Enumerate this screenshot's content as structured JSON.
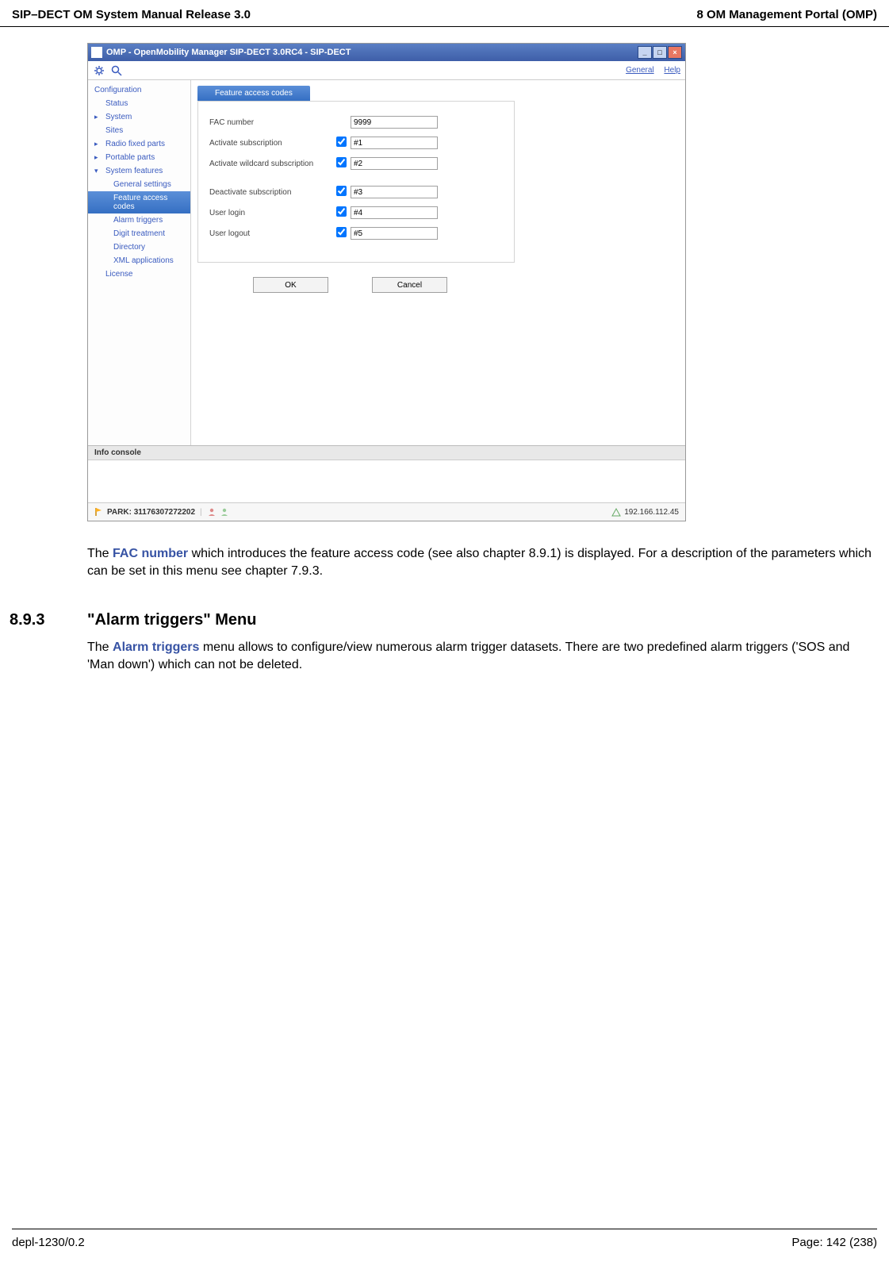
{
  "header": {
    "left": "SIP–DECT OM System Manual Release 3.0",
    "right": "8 OM Management Portal (OMP)"
  },
  "window": {
    "title": "OMP - OpenMobility Manager SIP-DECT 3.0RC4 - SIP-DECT",
    "links": {
      "general": "General",
      "help": "Help"
    }
  },
  "sidebar": {
    "root": "Configuration",
    "items": {
      "status": "Status",
      "system": "System",
      "sites": "Sites",
      "rfp": "Radio fixed parts",
      "pp": "Portable parts",
      "sysfeat": "System features",
      "license": "License"
    },
    "subs": {
      "general": "General settings",
      "fac": "Feature access codes",
      "alarm": "Alarm triggers",
      "digit": "Digit treatment",
      "directory": "Directory",
      "xml": "XML applications"
    }
  },
  "panel": {
    "tab": "Feature access codes",
    "rows": {
      "facnum": {
        "label": "FAC number",
        "value": "9999"
      },
      "actsub": {
        "label": "Activate subscription",
        "value": "#1"
      },
      "actwc": {
        "label": "Activate wildcard subscription",
        "value": "#2"
      },
      "deact": {
        "label": "Deactivate subscription",
        "value": "#3"
      },
      "login": {
        "label": "User login",
        "value": "#4"
      },
      "logout": {
        "label": "User logout",
        "value": "#5"
      }
    },
    "buttons": {
      "ok": "OK",
      "cancel": "Cancel"
    }
  },
  "console": {
    "title": "Info console"
  },
  "statusbar": {
    "park": "PARK: 31176307272202",
    "ip": "192.166.112.45"
  },
  "doc": {
    "para1a": "The ",
    "kw1": "FAC number",
    "para1b": " which introduces the feature access code (see also chapter 8.9.1) is displayed. For a description of the parameters which can be set in this menu see chapter 7.9.3.",
    "secnum": "8.9.3",
    "sectitle": "\"Alarm triggers\" Menu",
    "para2a": "The ",
    "kw2": "Alarm triggers",
    "para2b": " menu allows to configure/view numerous alarm trigger datasets. There are two predefined alarm triggers ('SOS and 'Man down') which can not be deleted."
  },
  "footer": {
    "left": "depl-1230/0.2",
    "right": "Page: 142 (238)"
  }
}
